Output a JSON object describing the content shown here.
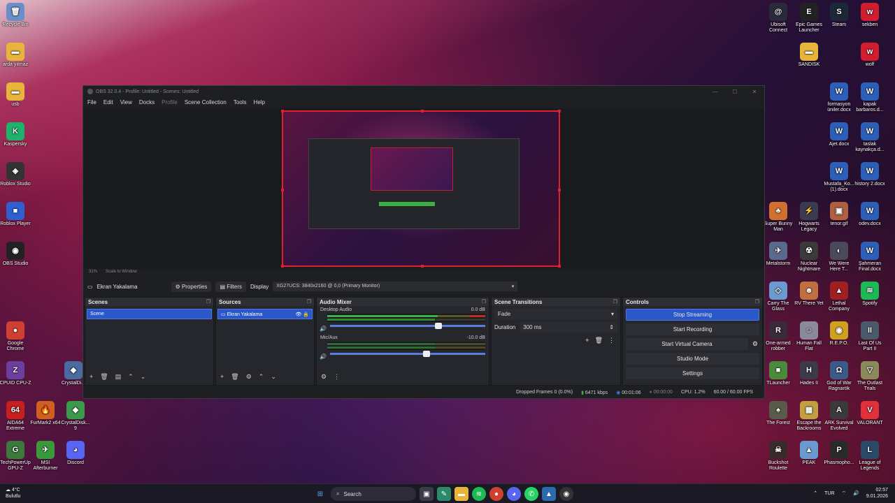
{
  "desktop_left": [
    {
      "label": "Recycle Bin",
      "icon": "recycle-bin-icon",
      "color": "#6a8fc8",
      "glyph": "🗑"
    },
    {
      "label": "arda yılmaz",
      "icon": "folder-icon",
      "color": "#e8b43a",
      "glyph": "▬"
    },
    {
      "label": "usb",
      "icon": "folder-icon",
      "color": "#e8b43a",
      "glyph": "▬"
    },
    {
      "label": "Kaspersky",
      "icon": "kaspersky-icon",
      "color": "#1db36b",
      "glyph": "K"
    },
    {
      "label": "Roblox Studio",
      "icon": "roblox-studio-icon",
      "color": "#333333",
      "glyph": "◈"
    },
    {
      "label": "Roblox Player",
      "icon": "roblox-player-icon",
      "color": "#2f5fd0",
      "glyph": "■"
    },
    {
      "label": "OBS Studio",
      "icon": "obs-icon",
      "color": "#222222",
      "glyph": "◉"
    },
    {
      "label": "Google Chrome",
      "icon": "chrome-icon",
      "color": "#d04030",
      "glyph": "●"
    },
    {
      "label": "CPUID CPU-Z",
      "icon": "cpuz-icon",
      "color": "#6a3fa0",
      "glyph": "Z"
    },
    {
      "label": "AIDA64 Extreme",
      "icon": "aida64-icon",
      "color": "#c81e1e",
      "glyph": "64"
    },
    {
      "label": "TechPowerUp GPU-Z",
      "icon": "gpuz-icon",
      "color": "#3a7a3a",
      "glyph": "G"
    }
  ],
  "desktop_left2": [
    {
      "label": "CrystalDi...",
      "icon": "crystaldisk-icon",
      "color": "#4a6aa0",
      "glyph": "◆"
    },
    {
      "label": "FurMark2 x64",
      "icon": "furmark-icon",
      "color": "#d06020",
      "glyph": "🔥"
    },
    {
      "label": "CrystalDisk... 9",
      "icon": "crystaldisk-icon",
      "color": "#3a9a4a",
      "glyph": "◆"
    },
    {
      "label": "MSI Afterburner",
      "icon": "msi-afterburner-icon",
      "color": "#3a9a3a",
      "glyph": "✈"
    },
    {
      "label": "Discord",
      "icon": "discord-icon",
      "color": "#5865f2",
      "glyph": "◕"
    }
  ],
  "desktop_right": [
    {
      "label": "Ubisoft Connect",
      "icon": "ubisoft-icon",
      "color": "#2a2a3a",
      "glyph": "@"
    },
    {
      "label": "Epic Games Launcher",
      "icon": "epic-icon",
      "color": "#222222",
      "glyph": "E"
    },
    {
      "label": "Steam",
      "icon": "steam-icon",
      "color": "#1b2838",
      "glyph": "S"
    },
    {
      "label": "sekben",
      "icon": "wolf-app-icon",
      "color": "#d01e2e",
      "glyph": "w"
    },
    {
      "label": "SANDISK",
      "icon": "folder-icon",
      "color": "#e8b43a",
      "glyph": "▬"
    },
    {
      "label": "wolf",
      "icon": "wolf-app-icon",
      "color": "#d01e2e",
      "glyph": "w"
    },
    {
      "label": "formasyon üniler.docx",
      "icon": "word-icon",
      "color": "#2b5fb8",
      "glyph": "W"
    },
    {
      "label": "kapak barbaros.d...",
      "icon": "word-icon",
      "color": "#2b5fb8",
      "glyph": "W"
    },
    {
      "label": "Ajet.docx",
      "icon": "word-icon",
      "color": "#2b5fb8",
      "glyph": "W"
    },
    {
      "label": "taslak kaynakça.d...",
      "icon": "word-icon",
      "color": "#2b5fb8",
      "glyph": "W"
    },
    {
      "label": "Mustafa_Ko... (1).docx",
      "icon": "word-icon",
      "color": "#2b5fb8",
      "glyph": "W"
    },
    {
      "label": "history 2.docx",
      "icon": "word-icon",
      "color": "#2b5fb8",
      "glyph": "W"
    },
    {
      "label": "Super Bunny Man",
      "icon": "game-icon",
      "color": "#d07030",
      "glyph": "♣"
    },
    {
      "label": "Hogwarts Legacy",
      "icon": "game-icon",
      "color": "#3a3a50",
      "glyph": "⚡"
    },
    {
      "label": "tenor.gif",
      "icon": "image-icon",
      "color": "#b06040",
      "glyph": "▣"
    },
    {
      "label": "odev.docx",
      "icon": "word-icon",
      "color": "#2b5fb8",
      "glyph": "W"
    },
    {
      "label": "Metalstorm",
      "icon": "game-icon",
      "color": "#5a6a8a",
      "glyph": "✈"
    },
    {
      "label": "Nuclear Nightmare",
      "icon": "game-icon",
      "color": "#3a3a3a",
      "glyph": "☢"
    },
    {
      "label": "We Were Here T...",
      "icon": "game-icon",
      "color": "#4a4a5a",
      "glyph": "◐"
    },
    {
      "label": "Şahmeran Final.docx",
      "icon": "word-icon",
      "color": "#2b5fb8",
      "glyph": "W"
    },
    {
      "label": "Carry The Glass",
      "icon": "game-icon",
      "color": "#6a9ad0",
      "glyph": "◇"
    },
    {
      "label": "RV There Yet",
      "icon": "game-icon",
      "color": "#c07040",
      "glyph": "☻"
    },
    {
      "label": "Lethal Company",
      "icon": "game-icon",
      "color": "#a02020",
      "glyph": "▲"
    },
    {
      "label": "Spotify",
      "icon": "spotify-icon",
      "color": "#1db954",
      "glyph": "≋"
    },
    {
      "label": "One-armed robber",
      "icon": "game-icon",
      "color": "#3a2a3a",
      "glyph": "R"
    },
    {
      "label": "Human Fall Flat",
      "icon": "game-icon",
      "color": "#8a8a9a",
      "glyph": "☺"
    },
    {
      "label": "R.E.P.O.",
      "icon": "game-icon",
      "color": "#d0a020",
      "glyph": "◉"
    },
    {
      "label": "Last Of Us Part II",
      "icon": "game-icon",
      "color": "#4a5a6a",
      "glyph": "II"
    },
    {
      "label": "TLauncher",
      "icon": "game-icon",
      "color": "#4a8a3a",
      "glyph": "■"
    },
    {
      "label": "Hades II",
      "icon": "game-icon",
      "color": "#3a3a4a",
      "glyph": "H"
    },
    {
      "label": "God of War Ragnarök",
      "icon": "game-icon",
      "color": "#3a5a8a",
      "glyph": "Ω"
    },
    {
      "label": "The Outlast Trials",
      "icon": "game-icon",
      "color": "#8a8a5a",
      "glyph": "▽"
    },
    {
      "label": "The Forest",
      "icon": "game-icon",
      "color": "#5a5a4a",
      "glyph": "♠"
    },
    {
      "label": "Escape the Backrooms",
      "icon": "game-icon",
      "color": "#c0a040",
      "glyph": "▦"
    },
    {
      "label": "ARK Survival Evolved",
      "icon": "game-icon",
      "color": "#3a3a3a",
      "glyph": "A"
    },
    {
      "label": "VALORANT",
      "icon": "valorant-icon",
      "color": "#e0303a",
      "glyph": "V"
    },
    {
      "label": "Buckshot Roulette",
      "icon": "game-icon",
      "color": "#3a2a2a",
      "glyph": "☠"
    },
    {
      "label": "PEAK",
      "icon": "game-icon",
      "color": "#6a9ad0",
      "glyph": "▲"
    },
    {
      "label": "Phasmopho...",
      "icon": "game-icon",
      "color": "#2a2a2a",
      "glyph": "P"
    },
    {
      "label": "League of Legends",
      "icon": "lol-icon",
      "color": "#2a4a6a",
      "glyph": "L"
    }
  ],
  "obs": {
    "title": "OBS 32.0.4 - Profile: Untitled - Scenes: Untitled",
    "menu": [
      "File",
      "Edit",
      "View",
      "Docks",
      "Profile",
      "Scene Collection",
      "Tools",
      "Help"
    ],
    "zoom": "31%",
    "scale_mode": "Scale to Window",
    "source_name": "Ekran Yakalama",
    "properties_label": "Properties",
    "filters_label": "Filters",
    "display_label": "Display",
    "display_value": "XG27UCS: 3840x2160 @ 0,0 (Primary Monitor)",
    "scenes": {
      "title": "Scenes",
      "items": [
        "Scene"
      ]
    },
    "sources": {
      "title": "Sources",
      "items": [
        "Ekran Yakalama"
      ]
    },
    "mixer": {
      "title": "Audio Mixer",
      "channels": [
        {
          "name": "Desktop Audio",
          "db": "0.0 dB",
          "level": 0.7
        },
        {
          "name": "Mic/Aux",
          "db": "-10.0 dB",
          "level": 0.62
        }
      ],
      "scale": [
        "-60",
        "-55",
        "-50",
        "-45",
        "-40",
        "-35",
        "-30",
        "-25",
        "-20",
        "-15",
        "-10",
        "-5",
        "0"
      ]
    },
    "transitions": {
      "title": "Scene Transitions",
      "type": "Fade",
      "duration_label": "Duration",
      "duration": "300 ms"
    },
    "controls": {
      "title": "Controls",
      "stop_streaming": "Stop Streaming",
      "start_recording": "Start Recording",
      "start_virtual_camera": "Start Virtual Camera",
      "studio_mode": "Studio Mode",
      "settings": "Settings"
    },
    "status": {
      "dropped": "Dropped Frames 0 (0.0%)",
      "bitrate": "6471 kbps",
      "stream_time": "00:01:06",
      "rec_time": "00:00:00",
      "cpu": "CPU: 1.2%",
      "fps": "60.00 / 60.00 FPS"
    }
  },
  "taskbar": {
    "temp": "4°C",
    "weather": "Bulutlu",
    "search": "Search",
    "lang": "TUR",
    "time": "02:57",
    "date": "9.01.2026"
  },
  "colors": {
    "accent": "#2c57c9",
    "preview_border": "#e0202a",
    "meter_green": "#3cb043",
    "meter_yellow": "#c8b428",
    "meter_red": "#c82828"
  }
}
